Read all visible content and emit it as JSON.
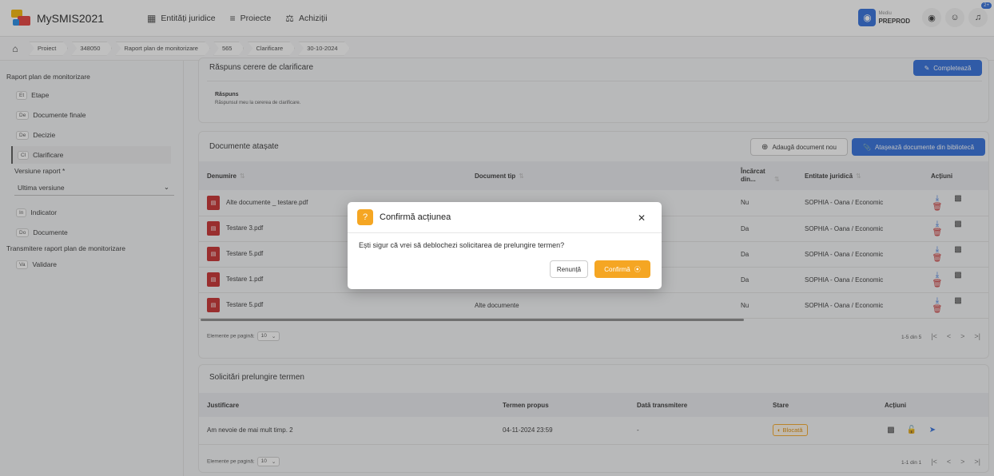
{
  "app": {
    "title": "MySMIS2021"
  },
  "nav": [
    {
      "label": "Entități juridice",
      "icon": "building-icon"
    },
    {
      "label": "Proiecte",
      "icon": "projects-icon"
    },
    {
      "label": "Achiziții",
      "icon": "scale-icon"
    }
  ],
  "env": {
    "small": "Mediu",
    "name": "PREPROD"
  },
  "notifications": {
    "count": "2+"
  },
  "breadcrumb": [
    "Proiect",
    "348050",
    "Raport plan de monitorizare",
    "565",
    "Clarificare",
    "30-10-2024"
  ],
  "sidebar": {
    "section1": "Raport plan de monitorizare",
    "items1": [
      {
        "tag": "Et",
        "label": "Etape"
      },
      {
        "tag": "De",
        "label": "Documente finale"
      },
      {
        "tag": "De",
        "label": "Decizie"
      },
      {
        "tag": "Cl",
        "label": "Clarificare"
      }
    ],
    "version_label": "Versiune raport *",
    "version_value": "Ultima versiune",
    "items2": [
      {
        "tag": "In",
        "label": "Indicator"
      },
      {
        "tag": "Do",
        "label": "Documente"
      }
    ],
    "section2": "Transmitere raport plan de monitorizare",
    "items3": [
      {
        "tag": "Va",
        "label": "Validare"
      }
    ]
  },
  "response_card": {
    "title": "Răspuns cerere de clarificare",
    "button": "Completează",
    "field_label": "Răspuns",
    "field_value": "Răspunsul meu la cererea de clarificare."
  },
  "docs_card": {
    "title": "Documente atașate",
    "add_button": "Adaugă document nou",
    "attach_button": "Atașează documente din bibliotecă",
    "columns": [
      "Denumire",
      "Document tip",
      "Încărcat din...",
      "Entitate juridică",
      "Acțiuni"
    ],
    "rows": [
      {
        "name": "Alte documente _ testare.pdf",
        "type": "",
        "uploaded": "Nu",
        "entity": "SOPHIA - Oana / Economic"
      },
      {
        "name": "Testare 3.pdf",
        "type": "",
        "uploaded": "Da",
        "entity": "SOPHIA - Oana / Economic"
      },
      {
        "name": "Testare 5.pdf",
        "type": "",
        "uploaded": "Da",
        "entity": "SOPHIA - Oana / Economic"
      },
      {
        "name": "Testare 1.pdf",
        "type": "",
        "uploaded": "Da",
        "entity": "SOPHIA - Oana / Economic"
      },
      {
        "name": "Testare 5.pdf",
        "type": "Alte documente",
        "uploaded": "Nu",
        "entity": "SOPHIA - Oana / Economic"
      }
    ],
    "per_page_label": "Elemente pe pagină:",
    "per_page": "10",
    "range": "1-5 din 5"
  },
  "requests_card": {
    "title": "Solicitări prelungire termen",
    "columns": [
      "Justificare",
      "Termen propus",
      "Dată transmitere",
      "Stare",
      "Acțiuni"
    ],
    "rows": [
      {
        "justification": "Am nevoie de mai mult timp. 2",
        "term": "04-11-2024 23:59",
        "sent": "-",
        "status": "Blocată"
      }
    ],
    "per_page_label": "Elemente pe pagină:",
    "per_page": "10",
    "range": "1-1 din 1"
  },
  "modal": {
    "title": "Confirmă acțiunea",
    "message": "Ești sigur că vrei să deblochezi solicitarea de prelungire termen?",
    "cancel": "Renunță",
    "confirm": "Confirmă"
  },
  "colors": {
    "primary": "#2b6bdb",
    "warning": "#f5a623",
    "danger": "#c62828"
  }
}
